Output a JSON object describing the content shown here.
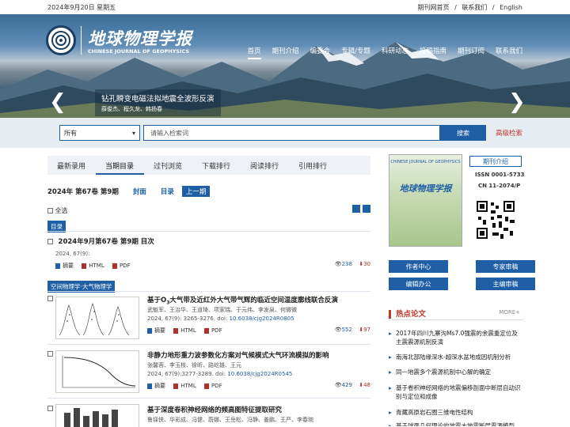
{
  "topbar": {
    "date": "2024年9月20日 星期五",
    "links": [
      "期刊网首页",
      "/",
      "联系我们",
      "/",
      "English"
    ]
  },
  "banner": {
    "logo_cn": "地球物理学报",
    "logo_en": "CHINESE JOURNAL OF GEOPHYSICS",
    "nav": [
      "首页",
      "期刊介绍",
      "编委会",
      "专辑/专题",
      "科研动态",
      "投稿指南",
      "期刊订阅",
      "联系我们"
    ],
    "caption_title": "钻孔瞬变电磁法拟地震全波形反演",
    "caption_authors": "薛俊杰、程久龙、韩扬春"
  },
  "search": {
    "select": "所有",
    "placeholder": "请输入检索词",
    "button": "搜索",
    "advanced": "高级检索"
  },
  "tabs": [
    "最新录用",
    "当期目录",
    "过刊浏览",
    "下载排行",
    "阅读排行",
    "引用排行"
  ],
  "issue": {
    "label": "2024年 第67卷 第9期",
    "cover": "封面",
    "toc": "目录",
    "prev": "上一期"
  },
  "select_all": "全选",
  "toc_tag": "目录",
  "toc_item": {
    "title": "2024年9月第67卷 第9期 目次",
    "meta": "2024, 67(9):",
    "views": "238",
    "downloads": "30"
  },
  "section_tag": "空间物理学·大气物理学",
  "link_labels": {
    "abstract": "摘要",
    "html": "HTML",
    "pdf": "PDF"
  },
  "articles": [
    {
      "title_pre": "基于O",
      "title_sub": "3",
      "title_post": "大气带及近红外大气带气辉的临近空间温度廓线联合反演",
      "authors": "武魁军、王治华、王道琦、项家瑞、于元伟、李发泉、何微微",
      "meta": "2024, 67(9): 3265-3276. doi: ",
      "doi": "10.6038/cjg2024R0805",
      "views": "552",
      "downloads": "97"
    },
    {
      "title_pre": "非静力地形重力波参数化方案对气候模式大气环流模拟的影响",
      "title_sub": "",
      "title_post": "",
      "authors": "张馨蓉、李玉枝、徐昕、路屹雄、王元",
      "meta": "2024, 67(9):3277-3289. doi: ",
      "doi": "10.6038/cjg2024R0545",
      "views": "429",
      "downloads": "48"
    },
    {
      "title_pre": "基于深度卷积神经网络的频高图特征提取研究",
      "title_sub": "",
      "title_post": "",
      "authors": "鲁铎侠、华彩成、冯健、蔚娜、王岳松、冯静、姜鹏、王严、李春琬",
      "meta": "",
      "doi": "",
      "views": "",
      "downloads": ""
    }
  ],
  "sidebar": {
    "intro_btn": "期刊介绍",
    "issn": "ISSN 0001-5733",
    "cn": "CN 11-2074/P",
    "cover_title": "地球物理学报",
    "cover_en": "CHINESE JOURNAL OF GEOPHYSICS",
    "buttons": [
      "作者中心",
      "专家审稿",
      "编辑办公",
      "主编审稿"
    ],
    "hot_title": "热点论文",
    "more": "MORE+"
  },
  "hot_papers": [
    "2017年四川九寨沟Ms7.0强震的余震重定位及主震震源机制反演",
    "南海北部陆缘深水-超深水盆地成因机制分析",
    "同一地震多个震源机制中心解的确定",
    "基于卷积神经网络的地震偏移剖面中断层自动识别与定位和成像",
    "青藏高原岩石圈三维电性结构",
    "基于球面几何理论的地震大地震断层震源模型"
  ]
}
